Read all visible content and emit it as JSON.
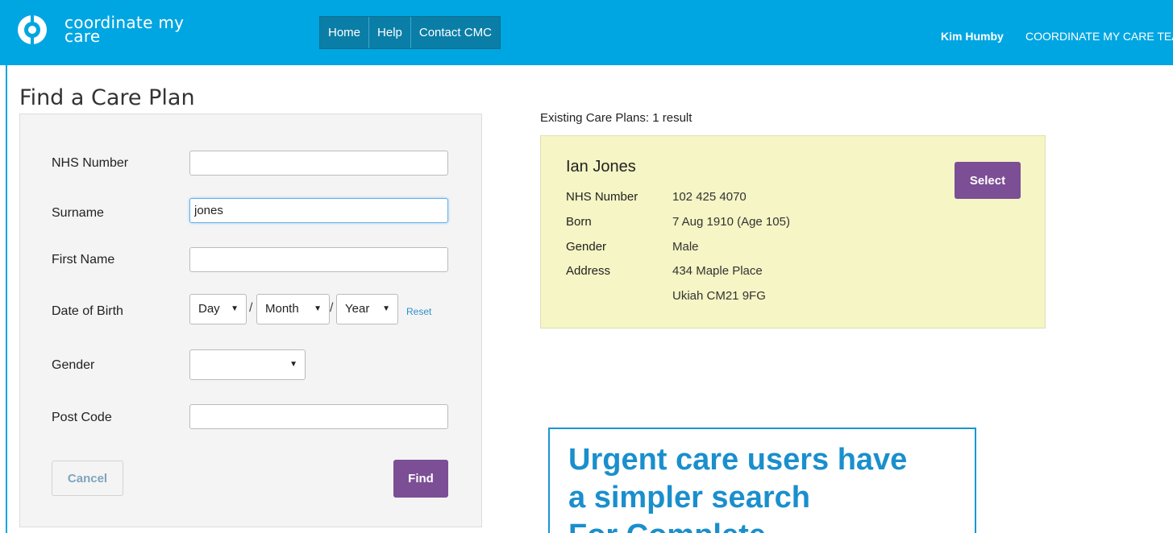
{
  "header": {
    "logo_text_line1": "coordinate my",
    "logo_text_line2": "care",
    "nav": [
      "Home",
      "Help",
      "Contact CMC"
    ],
    "user_name": "Kim Humby",
    "team_name": "COORDINATE MY CARE TEA",
    "brand_color": "#00a6e2"
  },
  "find_form": {
    "title": "Find a Care Plan",
    "labels": {
      "nhs_number": "NHS Number",
      "surname": "Surname",
      "first_name": "First Name",
      "date_of_birth": "Date of Birth",
      "gender": "Gender",
      "post_code": "Post Code"
    },
    "values": {
      "nhs_number": "",
      "surname": "jones",
      "first_name": "",
      "gender": "",
      "post_code": ""
    },
    "dob": {
      "day": "Day",
      "month": "Month",
      "year": "Year",
      "separator": "/"
    },
    "reset_label": "Reset",
    "cancel_label": "Cancel",
    "find_label": "Find"
  },
  "results": {
    "heading": "Existing Care Plans: 1 result",
    "items": [
      {
        "name": "Ian Jones",
        "nhs_number_label": "NHS Number",
        "nhs_number": "102 425 4070",
        "born_label": "Born",
        "born": "7 Aug 1910 (Age 105)",
        "gender_label": "Gender",
        "gender": "Male",
        "address_label": "Address",
        "address_line1": "434 Maple Place",
        "address_line2": "Ukiah CM21 9FG",
        "select_label": "Select"
      }
    ]
  },
  "callout": {
    "line1": "Urgent care users have",
    "line2": "a simpler search",
    "line3": "For Complete"
  },
  "icons": {
    "logo": "cmc-logo-icon",
    "dropdown": "caret-down-icon"
  },
  "colors": {
    "accent": "#7c4e96",
    "result_bg": "#f5f5c5",
    "callout": "#1a8fcd"
  }
}
